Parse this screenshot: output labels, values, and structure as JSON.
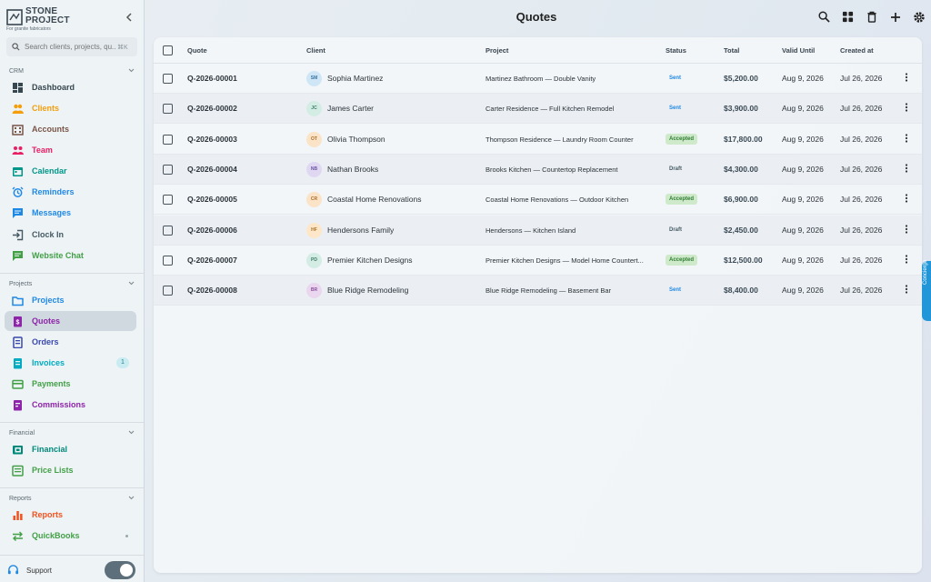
{
  "brand": {
    "name_line1": "STONE",
    "name_line2": "PROJECT",
    "tagline": "For granite fabricators"
  },
  "search": {
    "placeholder": "Search clients, projects, qu...",
    "shortcut": "⌘K"
  },
  "sidebar": {
    "sections": [
      {
        "title": "CRM",
        "items": [
          {
            "label": "Dashboard",
            "icon": "dashboard-icon",
            "color": "#37474f"
          },
          {
            "label": "Clients",
            "icon": "people-icon",
            "color": "#f59e0b"
          },
          {
            "label": "Accounts",
            "icon": "building-icon",
            "color": "#795548"
          },
          {
            "label": "Team",
            "icon": "team-icon",
            "color": "#e91e63"
          },
          {
            "label": "Calendar",
            "icon": "calendar-icon",
            "color": "#009688"
          },
          {
            "label": "Reminders",
            "icon": "alarm-icon",
            "color": "#1e88e5"
          },
          {
            "label": "Messages",
            "icon": "chat-icon",
            "color": "#1e88e5"
          },
          {
            "label": "Clock In",
            "icon": "login-icon",
            "color": "#455a64"
          },
          {
            "label": "Website Chat",
            "icon": "website-chat-icon",
            "color": "#43a047"
          }
        ]
      },
      {
        "title": "Projects",
        "items": [
          {
            "label": "Projects",
            "icon": "folder-icon",
            "color": "#1e88e5"
          },
          {
            "label": "Quotes",
            "icon": "quote-doc-icon",
            "color": "#8e24aa",
            "active": true
          },
          {
            "label": "Orders",
            "icon": "orders-icon",
            "color": "#3949ab"
          },
          {
            "label": "Invoices",
            "icon": "invoice-icon",
            "color": "#00acc1",
            "badge": "1"
          },
          {
            "label": "Payments",
            "icon": "card-icon",
            "color": "#43a047"
          },
          {
            "label": "Commissions",
            "icon": "commission-icon",
            "color": "#8e24aa"
          }
        ]
      },
      {
        "title": "Financial",
        "items": [
          {
            "label": "Financial",
            "icon": "financial-icon",
            "color": "#00897b"
          },
          {
            "label": "Price Lists",
            "icon": "pricelist-icon",
            "color": "#43a047"
          }
        ]
      },
      {
        "title": "Reports",
        "items": [
          {
            "label": "Reports",
            "icon": "bar-chart-icon",
            "color": "#f4511e"
          },
          {
            "label": "QuickBooks",
            "icon": "sync-icon",
            "color": "#43a047"
          }
        ]
      }
    ],
    "support_label": "Support"
  },
  "header": {
    "title": "Quotes"
  },
  "table": {
    "columns": [
      "Quote",
      "Client",
      "Project",
      "Status",
      "Total",
      "Valid Until",
      "Created at"
    ],
    "rows": [
      {
        "quote": "Q-2026-00001",
        "initials": "SM",
        "client": "Sophia Martinez",
        "project": "Martinez Bathroom — Double Vanity",
        "status": "Sent",
        "total": "$5,200.00",
        "valid": "Aug 9, 2026",
        "created": "Jul 26, 2026",
        "avatar_bg": "#cfe6f7",
        "avatar_fg": "#3b73a3"
      },
      {
        "quote": "Q-2026-00002",
        "initials": "JC",
        "client": "James Carter",
        "project": "Carter Residence — Full Kitchen Remodel",
        "status": "Sent",
        "total": "$3,900.00",
        "valid": "Aug 9, 2026",
        "created": "Jul 26, 2026",
        "avatar_bg": "#d3ece4",
        "avatar_fg": "#3e7a67"
      },
      {
        "quote": "Q-2026-00003",
        "initials": "OT",
        "client": "Olivia Thompson",
        "project": "Thompson Residence — Laundry Room Counter",
        "status": "Accepted",
        "total": "$17,800.00",
        "valid": "Aug 9, 2026",
        "created": "Jul 26, 2026",
        "avatar_bg": "#fbe3c7",
        "avatar_fg": "#a86c2a"
      },
      {
        "quote": "Q-2026-00004",
        "initials": "NB",
        "client": "Nathan Brooks",
        "project": "Brooks Kitchen — Countertop Replacement",
        "status": "Draft",
        "total": "$4,300.00",
        "valid": "Aug 9, 2026",
        "created": "Jul 26, 2026",
        "avatar_bg": "#e0d8f2",
        "avatar_fg": "#6a55a0"
      },
      {
        "quote": "Q-2026-00005",
        "initials": "CR",
        "client": "Coastal Home Renovations",
        "project": "Coastal Home Renovations — Outdoor Kitchen",
        "status": "Accepted",
        "total": "$6,900.00",
        "valid": "Aug 9, 2026",
        "created": "Jul 26, 2026",
        "avatar_bg": "#fbe3c7",
        "avatar_fg": "#a86c2a"
      },
      {
        "quote": "Q-2026-00006",
        "initials": "HF",
        "client": "Hendersons Family",
        "project": "Hendersons — Kitchen Island",
        "status": "Draft",
        "total": "$2,450.00",
        "valid": "Aug 9, 2026",
        "created": "Jul 26, 2026",
        "avatar_bg": "#fde7c8",
        "avatar_fg": "#a8702a"
      },
      {
        "quote": "Q-2026-00007",
        "initials": "PD",
        "client": "Premier Kitchen Designs",
        "project": "Premier Kitchen Designs — Model Home Countert...",
        "status": "Accepted",
        "total": "$12,500.00",
        "valid": "Aug 9, 2026",
        "created": "Jul 26, 2026",
        "avatar_bg": "#d3ece4",
        "avatar_fg": "#3e7a67"
      },
      {
        "quote": "Q-2026-00008",
        "initials": "BR",
        "client": "Blue Ridge Remodeling",
        "project": "Blue Ridge Remodeling — Basement Bar",
        "status": "Sent",
        "total": "$8,400.00",
        "valid": "Aug 9, 2026",
        "created": "Jul 26, 2026",
        "avatar_bg": "#ead6ef",
        "avatar_fg": "#8a4f99"
      }
    ]
  },
  "status_colors": {
    "Sent": {
      "bg": "transparent",
      "fg": "#1e88e5"
    },
    "Accepted": {
      "bg": "#cfeacb",
      "fg": "#2e7d32"
    },
    "Draft": {
      "bg": "transparent",
      "fg": "#455a64"
    }
  },
  "side_tab_label": "Concierge"
}
